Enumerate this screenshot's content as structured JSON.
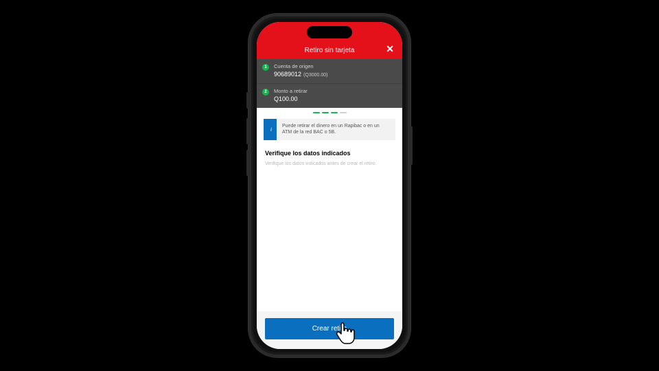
{
  "header": {
    "title": "Retiro sin tarjeta"
  },
  "steps": [
    {
      "num": "1",
      "label": "Cuenta de origen",
      "value": "90689012",
      "sub": "(Q3000.00)"
    },
    {
      "num": "2",
      "label": "Monto a retirar",
      "value": "Q100.00",
      "sub": ""
    }
  ],
  "info": {
    "text": "Puede retirar el dinero en un Rapibac o en un ATM de la red BAC o 5B."
  },
  "verify": {
    "title": "Verifique los datos indicados",
    "hint": "Verifique los datos indicados antes de crear el retiro."
  },
  "action": {
    "primary": "Crear retiro"
  }
}
